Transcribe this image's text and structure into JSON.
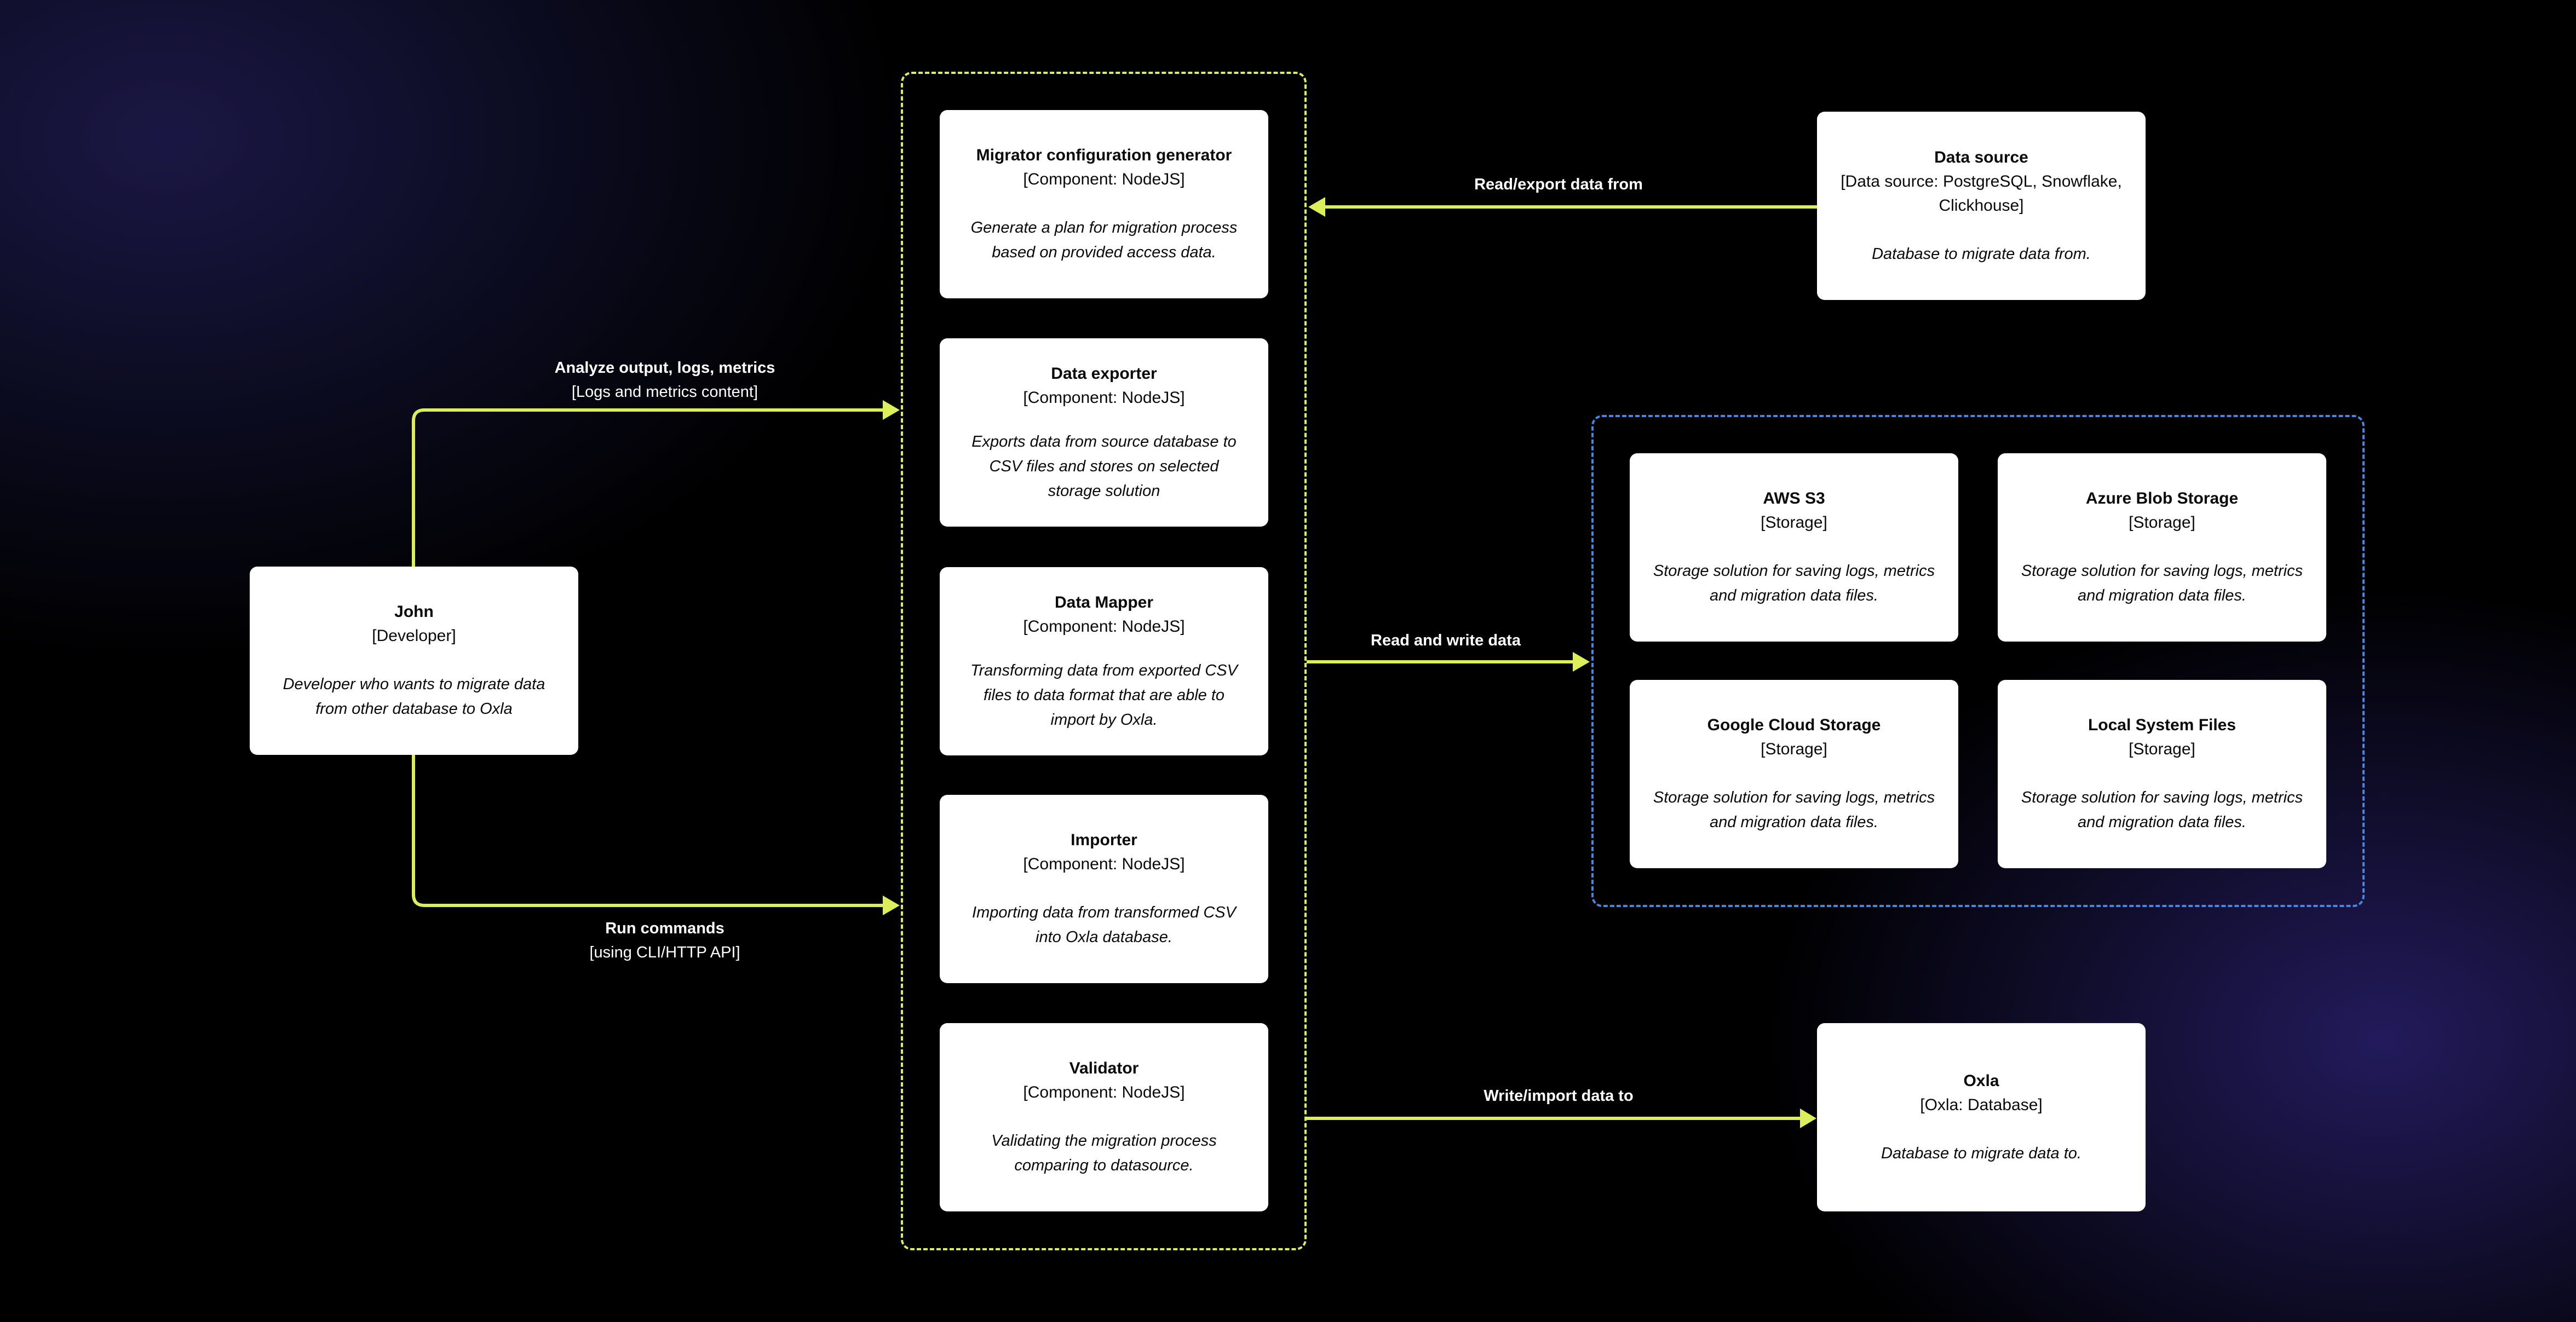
{
  "colors": {
    "arrow": "#dcef5a",
    "system_boundary": "#dcef5a",
    "storage_boundary": "#4a86e0",
    "card_bg": "#ffffff",
    "card_text": "#0a0a0a",
    "label_text": "#ffffff",
    "background": "#000000",
    "glow": "#221c5a"
  },
  "person": {
    "title": "John",
    "kind": "[Developer]",
    "description": "Developer who wants to migrate data from other database to Oxla"
  },
  "components": [
    {
      "title": "Migrator configuration generator",
      "kind": "[Component: NodeJS]",
      "description": "Generate a plan for migration process based on provided access data."
    },
    {
      "title": "Data exporter",
      "kind": "[Component: NodeJS]",
      "description": "Exports data from source database to CSV files and stores on selected storage solution"
    },
    {
      "title": "Data Mapper",
      "kind": "[Component: NodeJS]",
      "description": "Transforming data from exported CSV files to data format that are able to import by Oxla."
    },
    {
      "title": "Importer",
      "kind": "[Component: NodeJS]",
      "description": "Importing data from transformed CSV into Oxla database."
    },
    {
      "title": "Validator",
      "kind": "[Component: NodeJS]",
      "description": "Validating the migration process comparing to datasource."
    }
  ],
  "data_source": {
    "title": "Data source",
    "kind": "[Data source: PostgreSQL, Snowflake, Clickhouse]",
    "description": "Database to migrate data from."
  },
  "storages": [
    {
      "title": "AWS S3",
      "kind": "[Storage]",
      "description": "Storage solution for saving logs, metrics and migration data files."
    },
    {
      "title": "Azure Blob Storage",
      "kind": "[Storage]",
      "description": "Storage solution for saving logs, metrics and migration data files."
    },
    {
      "title": "Google Cloud Storage",
      "kind": "[Storage]",
      "description": "Storage solution for saving logs, metrics and migration data files."
    },
    {
      "title": "Local System Files",
      "kind": "[Storage]",
      "description": "Storage solution for saving logs, metrics and migration data files."
    }
  ],
  "target_db": {
    "title": "Oxla",
    "kind": "[Oxla: Database]",
    "description": "Database to migrate data to."
  },
  "relations": {
    "analyze": {
      "title": "Analyze output, logs, metrics",
      "subtitle": "[Logs and metrics content]"
    },
    "run": {
      "title": "Run commands",
      "subtitle": "[using CLI/HTTP API]"
    },
    "read_export": {
      "title": "Read/export data from"
    },
    "read_write": {
      "title": "Read and write data"
    },
    "write_import": {
      "title": "Write/import data to"
    }
  }
}
